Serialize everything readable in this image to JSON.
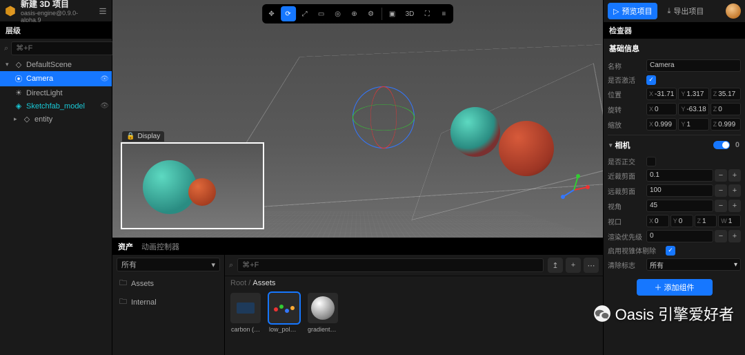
{
  "header": {
    "project_title": "新建 3D 项目",
    "engine_version": "oasis-engine@0.9.0-alpha.9"
  },
  "hierarchy": {
    "title": "层级",
    "search_placeholder": "⌘+F",
    "items": [
      {
        "label": "DefaultScene",
        "icon": "scene",
        "depth": 0,
        "expanded": true
      },
      {
        "label": "Camera",
        "icon": "camera",
        "depth": 1,
        "selected": true
      },
      {
        "label": "DirectLight",
        "icon": "light",
        "depth": 1
      },
      {
        "label": "Sketchfab_model",
        "icon": "model",
        "depth": 1,
        "cyan": true
      },
      {
        "label": "entity",
        "icon": "entity",
        "depth": 1
      }
    ]
  },
  "viewport_toolbar": {
    "mode_3d": "3D"
  },
  "display_overlay_label": "Display",
  "inspector": {
    "title": "检查器",
    "section_basic": "基础信息",
    "name_label": "名称",
    "name_value": "Camera",
    "active_label": "是否激活",
    "position_label": "位置",
    "position": {
      "x": "-31.71",
      "y": "1.317",
      "z": "35.17"
    },
    "rotation_label": "旋转",
    "rotation": {
      "x": "0",
      "y": "-63.18",
      "z": "0"
    },
    "scale_label": "缩放",
    "scale": {
      "x": "0.999",
      "y": "1",
      "z": "0.999"
    },
    "section_camera": "相机",
    "ortho_label": "是否正交",
    "near_label": "近裁剪面",
    "near_value": "0.1",
    "far_label": "远裁剪面",
    "far_value": "100",
    "fov_label": "视角",
    "fov_value": "45",
    "viewport_label": "视口",
    "viewport": {
      "x": "0",
      "y": "0",
      "z": "1",
      "w": "1"
    },
    "priority_label": "渲染优先级",
    "priority_value": "0",
    "frustum_label": "启用视锥体剔除",
    "clear_label": "清除标志",
    "clear_value": "所有",
    "add_component": "添加组件",
    "prefix_x": "X",
    "prefix_y": "Y",
    "prefix_z": "Z",
    "prefix_w": "W",
    "badge": "0"
  },
  "top_buttons": {
    "preview": "预览项目",
    "export": "导出项目"
  },
  "assets": {
    "tab1": "资产",
    "tab2": "动画控制器",
    "filter_all": "所有",
    "search_placeholder": "⌘+F",
    "folders": [
      "Assets",
      "Internal"
    ],
    "breadcrumb_root": "Root",
    "breadcrumb_current": "Assets",
    "items": [
      {
        "label": "carbon (…"
      },
      {
        "label": "low_poly…",
        "selected": true
      },
      {
        "label": "gradient_…"
      }
    ]
  },
  "watermark": "Oasis 引擎爱好者"
}
